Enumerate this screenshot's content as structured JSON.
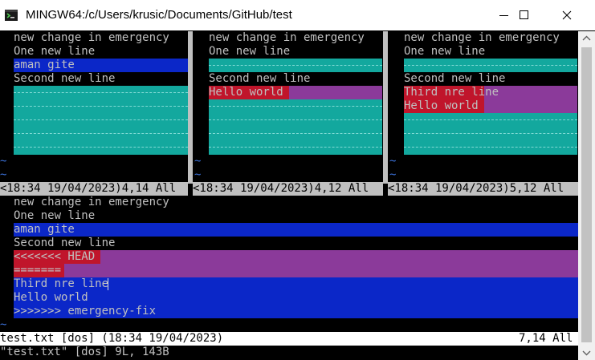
{
  "window": {
    "title": "MINGW64:/c/Users/krusic/Documents/GitHub/test"
  },
  "panes": {
    "local": {
      "lines": [
        "new change in emergency",
        "One new line",
        "aman gite",
        "Second new line"
      ],
      "status": "<18:34 19/04/2023)4,14 All"
    },
    "base": {
      "lines": [
        "new change in emergency",
        "One new line",
        "",
        "Second new line",
        "Hello world"
      ],
      "status": "<18:34 19/04/2023)4,12 All"
    },
    "remote": {
      "lines": [
        "new change in emergency",
        "One new line",
        "",
        "Second new line",
        "Third nre line",
        "Hello world"
      ],
      "status": "<18:34 19/04/2023)5,12 All"
    }
  },
  "merged": {
    "lines": [
      "new change in emergency",
      "One new line",
      "aman gite",
      "Second new line",
      "<<<<<<< HEAD",
      "=======",
      "Third nre line",
      "Hello world",
      ">>>>>>> emergency-fix"
    ],
    "status_left": "test.txt [dos] (18:34 19/04/2023)",
    "status_right": "7,14 All"
  },
  "message_line": "\"test.txt\" [dos] 9L, 143B",
  "tilde_char": "~",
  "colors": {
    "diff_change": "#13a89e",
    "diff_add": "#0b27c8",
    "diff_text": "#8b3a9a",
    "conflict": "#c0152b"
  },
  "icons": {
    "app": "mingw-icon",
    "minimize": "minimize-icon",
    "maximize": "maximize-icon",
    "close": "close-icon"
  }
}
